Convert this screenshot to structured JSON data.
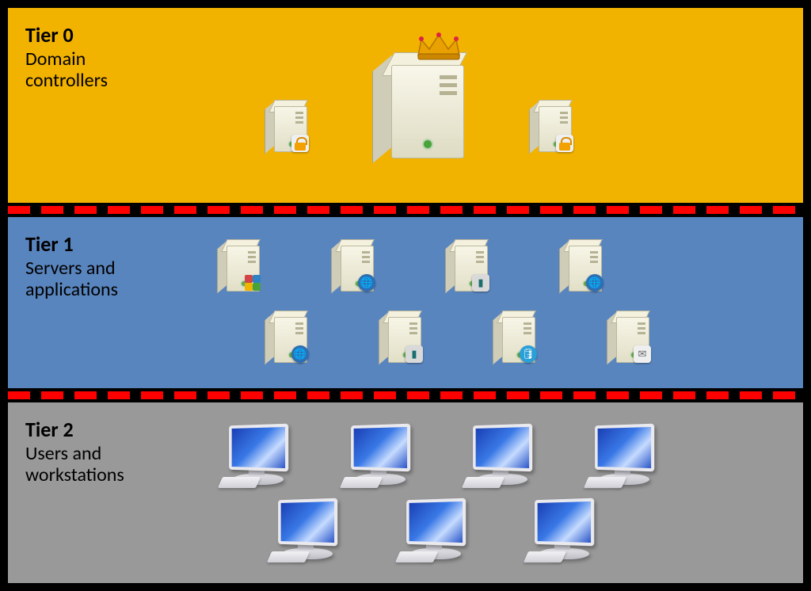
{
  "tiers": {
    "t0": {
      "title": "Tier 0",
      "subtitle": "Domain controllers"
    },
    "t1": {
      "title": "Tier 1",
      "subtitle": "Servers and applications"
    },
    "t2": {
      "title": "Tier 2",
      "subtitle": "Users and workstations"
    }
  },
  "icons": {
    "tier0": [
      {
        "name": "locked-server-left",
        "type": "server",
        "badge": "lock"
      },
      {
        "name": "king-domain-controller",
        "type": "big-server",
        "badge": "crown"
      },
      {
        "name": "locked-server-right",
        "type": "server",
        "badge": "lock"
      }
    ],
    "tier1_row1": [
      {
        "name": "app-server-puzzle",
        "type": "server",
        "badge": "puzzle"
      },
      {
        "name": "web-server-1",
        "type": "server",
        "badge": "globe"
      },
      {
        "name": "chip-server-1",
        "type": "server",
        "badge": "chip"
      },
      {
        "name": "web-server-2",
        "type": "server",
        "badge": "globe"
      }
    ],
    "tier1_row2": [
      {
        "name": "web-server-3",
        "type": "server",
        "badge": "globe"
      },
      {
        "name": "chip-server-2",
        "type": "server",
        "badge": "chip"
      },
      {
        "name": "db-server",
        "type": "server",
        "badge": "db"
      },
      {
        "name": "mail-server",
        "type": "server",
        "badge": "mail"
      }
    ],
    "tier2_row1": [
      {
        "name": "workstation-1",
        "type": "workstation"
      },
      {
        "name": "workstation-2",
        "type": "workstation"
      },
      {
        "name": "workstation-3",
        "type": "workstation"
      },
      {
        "name": "workstation-4",
        "type": "workstation"
      }
    ],
    "tier2_row2": [
      {
        "name": "workstation-5",
        "type": "workstation"
      },
      {
        "name": "workstation-6",
        "type": "workstation"
      },
      {
        "name": "workstation-7",
        "type": "workstation"
      }
    ]
  },
  "colors": {
    "tier0_bg": "#f2b200",
    "tier1_bg": "#5985be",
    "tier2_bg": "#999999",
    "separator_dash": "#ff0000",
    "separator_bg": "#000000"
  }
}
